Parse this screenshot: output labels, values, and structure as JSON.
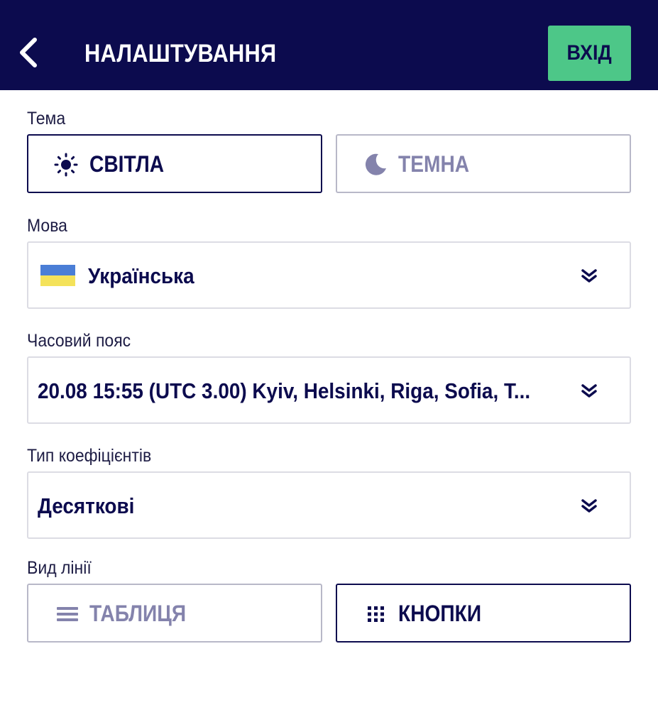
{
  "header": {
    "title": "НАЛАШТУВАННЯ",
    "login_label": "ВХІД",
    "back_icon": "chevron-left-icon",
    "background_color": "#0c0b4e",
    "login_color": "#4dc788"
  },
  "theme": {
    "label": "Тема",
    "options": [
      {
        "label": "СВІТЛА",
        "icon": "sun-icon",
        "selected": true
      },
      {
        "label": "ТЕМНА",
        "icon": "moon-icon",
        "selected": false
      }
    ]
  },
  "language": {
    "label": "Мова",
    "value": "Українська",
    "flag_icon": "ukraine-flag-icon",
    "flag_colors": [
      "#4a7ed6",
      "#f4e25a"
    ]
  },
  "timezone": {
    "label": "Часовий пояс",
    "value": "20.08 15:55 (UTC 3.00) Kyiv, Helsinki, Riga, Sofia, T..."
  },
  "odds": {
    "label": "Тип коефіцієнтів",
    "value": "Десяткові"
  },
  "line_view": {
    "label": "Вид лінії",
    "options": [
      {
        "label": "ТАБЛИЦЯ",
        "icon": "list-icon",
        "selected": false
      },
      {
        "label": "КНОПКИ",
        "icon": "grid-icon",
        "selected": true
      }
    ]
  }
}
